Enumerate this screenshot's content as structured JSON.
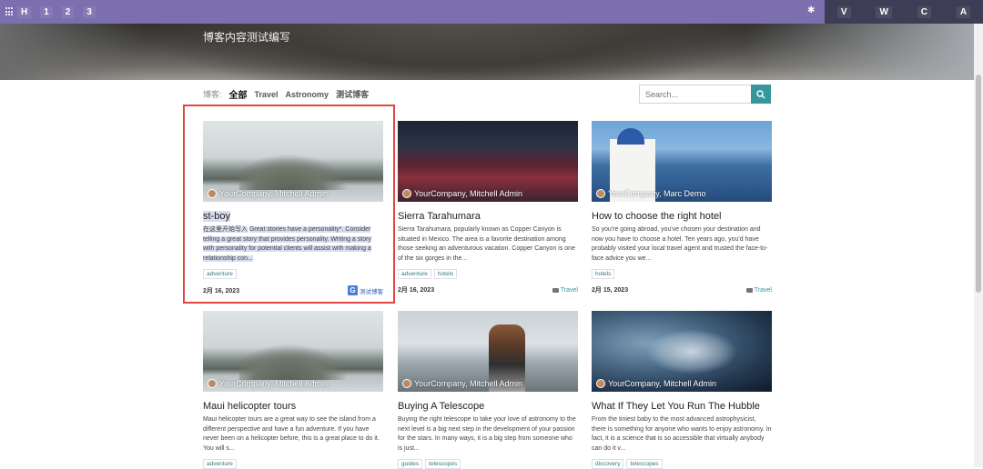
{
  "topbar": {
    "left_items": [
      "H",
      "1",
      "2",
      "3"
    ],
    "right_items": [
      "V",
      "W",
      "C",
      "A"
    ]
  },
  "hero": {
    "subtitle": "博客内容测试编写"
  },
  "filters": {
    "label": "博客:",
    "items": [
      {
        "label": "全部",
        "active": true
      },
      {
        "label": "Travel",
        "active": false
      },
      {
        "label": "Astronomy",
        "active": false
      },
      {
        "label": "测试博客",
        "active": false
      }
    ]
  },
  "search": {
    "placeholder": "Search..."
  },
  "posts": [
    {
      "author": "YourCompany, Mitchell Admin",
      "title": "st-boy",
      "excerpt_lead": "在这里开始写入",
      "excerpt": "Great stories have a personality*. Consider telling a great story that provides personality. Writing a story with personality for potential clients will assist with making a relationship con...",
      "tags": [
        "adventure"
      ],
      "date": "2月 16, 2023",
      "category": "测试博客",
      "image": "mountain"
    },
    {
      "author": "YourCompany, Mitchell Admin",
      "title": "Sierra Tarahumara",
      "excerpt": "Sierra Tarahumara, popularly known as Copper Canyon is situated in Mexico. The area is a favorite destination among those seeking an adventurous vacation. Copper Canyon is one of the six gorges in the...",
      "tags": [
        "adventure",
        "hotels"
      ],
      "date": "2月 16, 2023",
      "category": "Travel",
      "image": "canyon"
    },
    {
      "author": "YourCompany, Marc Demo",
      "title": "How to choose the right hotel",
      "excerpt": "So you're going abroad, you've chosen your destination and now you have to choose a hotel. Ten years ago, you'd have probably visited your local travel agent and trusted the face-to-face advice you we...",
      "tags": [
        "hotels"
      ],
      "date": "2月 15, 2023",
      "category": "Travel",
      "image": "santorini"
    },
    {
      "author": "YourCompany, Mitchell Admin",
      "title": "Maui helicopter tours",
      "excerpt": "Maui helicopter tours are a great way to see the island from a different perspective and have a fun adventure. If you have never been on a helicopter before, this is a great place to do it. You will s...",
      "tags": [
        "adventure"
      ],
      "image": "mountain"
    },
    {
      "author": "YourCompany, Mitchell Admin",
      "title": "Buying A Telescope",
      "excerpt": "Buying the right telescope to take your love of astronomy to the next level is a big next step in the development of your passion for the stars. In many ways, it is a big step from someone who is just...",
      "tags": [
        "guides",
        "telescopes"
      ],
      "image": "telescope"
    },
    {
      "author": "YourCompany, Mitchell Admin",
      "title": "What If They Let You Run The Hubble",
      "excerpt": "From the tiniest baby to the most advanced astrophysicist, there is something for anyone who wants to enjoy astronomy. In fact, it is a science that is so accessible that virtually anybody can do it v...",
      "tags": [
        "discovery",
        "telescopes"
      ],
      "image": "earth"
    }
  ],
  "colors": {
    "topbar": "#7c6faf",
    "accent": "#35979c",
    "selection": "#e0463f"
  }
}
